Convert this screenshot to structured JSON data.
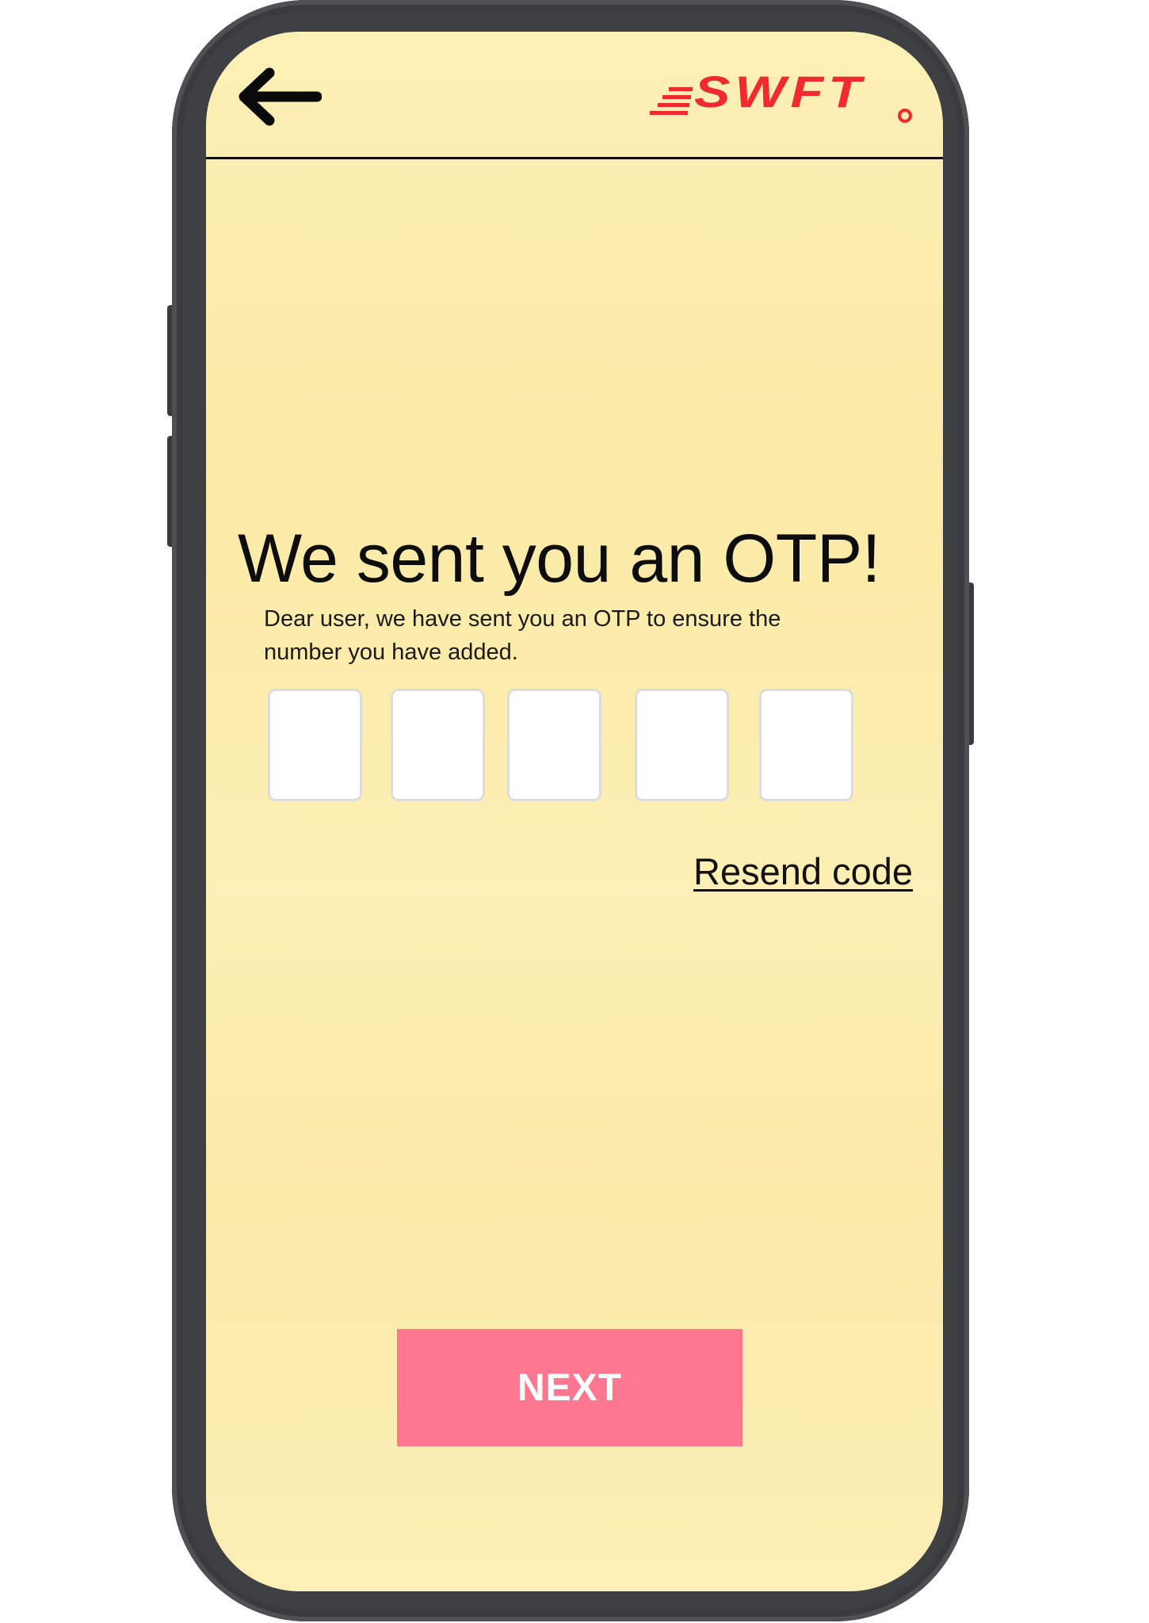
{
  "header": {
    "back_icon": "arrow-left-icon",
    "logo_text": "SWFT",
    "logo_color": "#f02a2e"
  },
  "main": {
    "title": "We sent you an OTP!",
    "description": "Dear user, we have sent you an OTP to ensure the number you have added.",
    "otp_boxes": [
      "",
      "",
      "",
      "",
      ""
    ],
    "resend_label": "Resend code",
    "next_label": "NEXT"
  },
  "colors": {
    "background": "#fdefb3",
    "next_button": "#ff7690",
    "phone_frame": "#3f4043"
  }
}
